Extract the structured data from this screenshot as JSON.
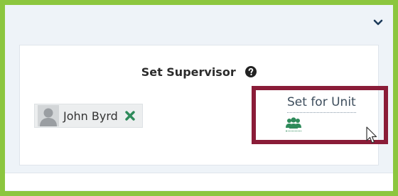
{
  "panel": {
    "title": "Set Supervisor",
    "collapse_icon": "chevron-down-icon",
    "help_icon": "question-circle-icon"
  },
  "supervisor": {
    "name": "John Byrd",
    "avatar_icon": "user-silhouette-icon",
    "remove_icon": "close-x-icon"
  },
  "unit_action": {
    "label": "Set for Unit",
    "icon": "group-users-icon"
  },
  "colors": {
    "frame_border": "#8cc63f",
    "highlight_border": "#8a1c38",
    "accent_green": "#2e8a5a"
  }
}
